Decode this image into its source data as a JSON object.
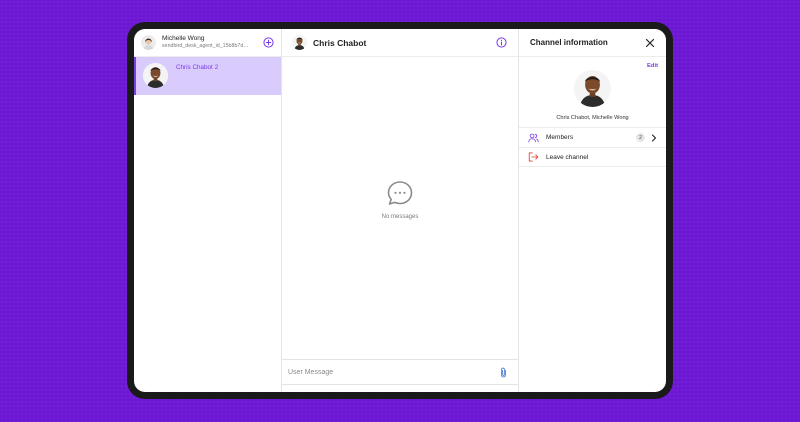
{
  "sidebar": {
    "user": {
      "name": "Michelle Wong",
      "id": "sendbird_desk_agent_id_15b8b7d…"
    },
    "channels": [
      {
        "name": "Chris Chabot",
        "member_count": "2"
      }
    ]
  },
  "conversation": {
    "title": "Chris Chabot",
    "empty_text": "No messages",
    "composer": {
      "value": "",
      "placeholder": "User Message"
    }
  },
  "channel_info": {
    "title": "Channel information",
    "edit_label": "Edit",
    "members_label": "Chris Chabot, Michelle Wong",
    "rows": [
      {
        "label": "Members",
        "count": "2"
      },
      {
        "label": "Leave channel"
      }
    ]
  },
  "colors": {
    "accent": "#7a3ae6",
    "selected_bg": "#d9ccfd",
    "danger": "#e5382b",
    "background": "#6e18d6"
  },
  "icons": [
    "plus-circle-icon",
    "info-icon",
    "close-icon",
    "chat-bubble-icon",
    "paperclip-icon",
    "members-icon",
    "leave-icon",
    "chevron-right-icon"
  ]
}
